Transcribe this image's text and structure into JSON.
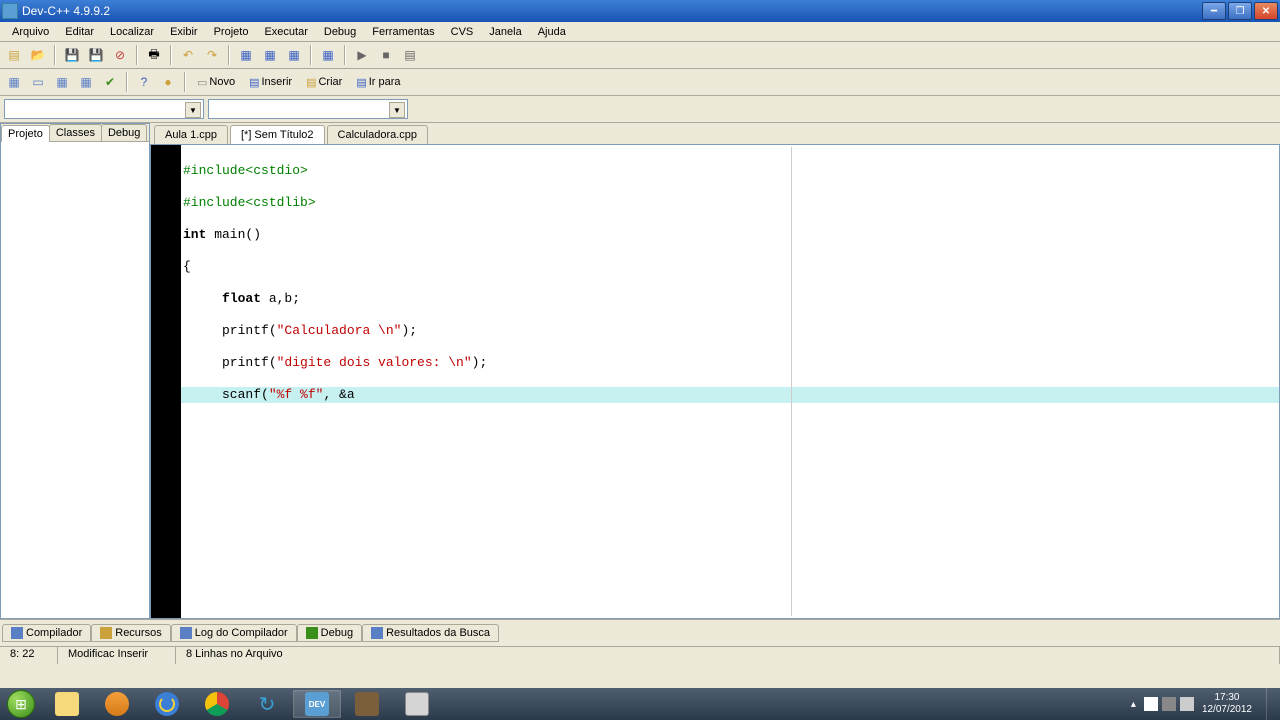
{
  "window": {
    "title": "Dev-C++ 4.9.9.2"
  },
  "menus": [
    "Arquivo",
    "Editar",
    "Localizar",
    "Exibir",
    "Projeto",
    "Executar",
    "Debug",
    "Ferramentas",
    "CVS",
    "Janela",
    "Ajuda"
  ],
  "toolbar2": {
    "novo": "Novo",
    "inserir": "Inserir",
    "criar": "Criar",
    "irpara": "Ir para"
  },
  "side_tabs": {
    "projeto": "Projeto",
    "classes": "Classes",
    "debug": "Debug"
  },
  "file_tabs": {
    "t0": "Aula 1.cpp",
    "t1": "[*] Sem Título2",
    "t2": "Calculadora.cpp"
  },
  "code": {
    "l1a": "#include<cstdio>",
    "l2a": "#include<cstdlib>",
    "l3a": "int",
    "l3b": " main()",
    "l4": "{",
    "l5a": "     ",
    "l5b": "float",
    "l5c": " a,b;",
    "l6a": "     printf(",
    "l6b": "\"Calculadora \\n\"",
    "l6c": ");",
    "l7a": "     printf(",
    "l7b": "\"digite dois valores: \\n\"",
    "l7c": ");",
    "l8a": "     scanf(",
    "l8b": "\"%f %f\"",
    "l8c": ", &a"
  },
  "bottom_tabs": {
    "compilador": "Compilador",
    "recursos": "Recursos",
    "log": "Log do Compilador",
    "debug": "Debug",
    "resultados": "Resultados da Busca"
  },
  "status": {
    "pos": "8: 22",
    "mode": "Modificac  Inserir",
    "lines": "8 Linhas no Arquivo"
  },
  "clock": {
    "time": "17:30",
    "date": "12/07/2012"
  }
}
